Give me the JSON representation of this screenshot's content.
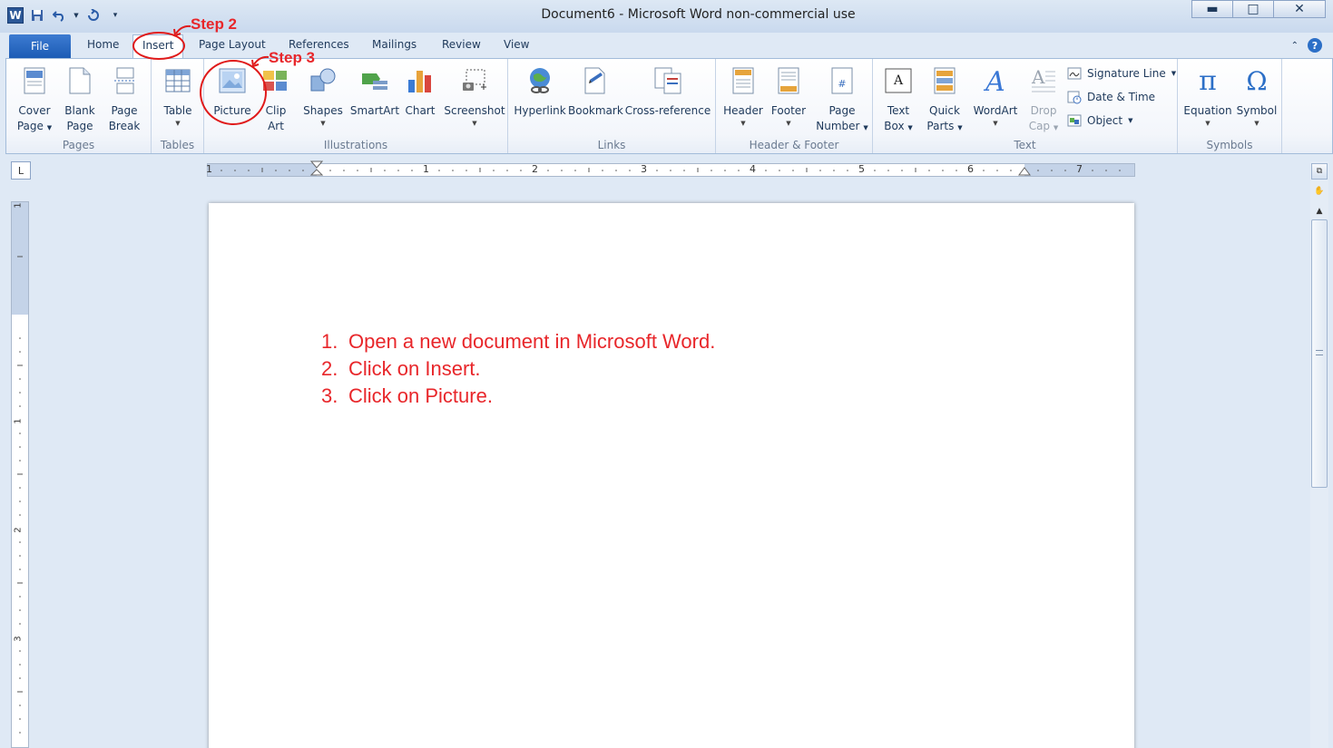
{
  "window": {
    "title": "Document6 - Microsoft Word non-commercial use",
    "app_logo": "W",
    "minimize_icon": "minimize-icon",
    "maximize_icon": "maximize-icon",
    "close_icon": "close-icon"
  },
  "tabs": {
    "file": "File",
    "items": [
      "Home",
      "Insert",
      "Page Layout",
      "References",
      "Mailings",
      "Review",
      "View"
    ],
    "active": "Insert"
  },
  "ribbon": {
    "pages": {
      "label": "Pages",
      "cover_page": [
        "Cover",
        "Page"
      ],
      "blank_page": [
        "Blank",
        "Page"
      ],
      "page_break": [
        "Page",
        "Break"
      ]
    },
    "tables": {
      "label": "Tables",
      "table": "Table"
    },
    "illustrations": {
      "label": "Illustrations",
      "picture": "Picture",
      "clip_art": [
        "Clip",
        "Art"
      ],
      "shapes": "Shapes",
      "smartart": "SmartArt",
      "chart": "Chart",
      "screenshot": "Screenshot"
    },
    "links": {
      "label": "Links",
      "hyperlink": "Hyperlink",
      "bookmark": "Bookmark",
      "cross_reference": "Cross-reference"
    },
    "header_footer": {
      "label": "Header & Footer",
      "header": "Header",
      "footer": "Footer",
      "page_number": [
        "Page",
        "Number"
      ]
    },
    "text": {
      "label": "Text",
      "text_box": [
        "Text",
        "Box"
      ],
      "quick_parts": [
        "Quick",
        "Parts"
      ],
      "wordart": "WordArt",
      "drop_cap": [
        "Drop",
        "Cap"
      ],
      "signature_line": "Signature Line",
      "date_time": "Date & Time",
      "object": "Object"
    },
    "symbols": {
      "label": "Symbols",
      "equation": "Equation",
      "symbol": "Symbol"
    }
  },
  "ruler": {
    "corner": "L",
    "h_numbers": [
      "1",
      "1",
      "2",
      "3",
      "4",
      "5",
      "6",
      "7"
    ],
    "v_numbers": [
      "1",
      "1",
      "2",
      "3"
    ]
  },
  "document": {
    "steps": [
      {
        "num": "1.",
        "text": "Open a new document in Microsoft Word."
      },
      {
        "num": "2.",
        "text": "Click on Insert."
      },
      {
        "num": "3.",
        "text": "Click on Picture."
      }
    ]
  },
  "annotations": {
    "step2": "Step 2",
    "step3": "Step 3",
    "color": "#e8262a"
  },
  "colors": {
    "file_tab": "#2b6bc5",
    "accent": "#1e395b",
    "annotation": "#e8262a"
  }
}
